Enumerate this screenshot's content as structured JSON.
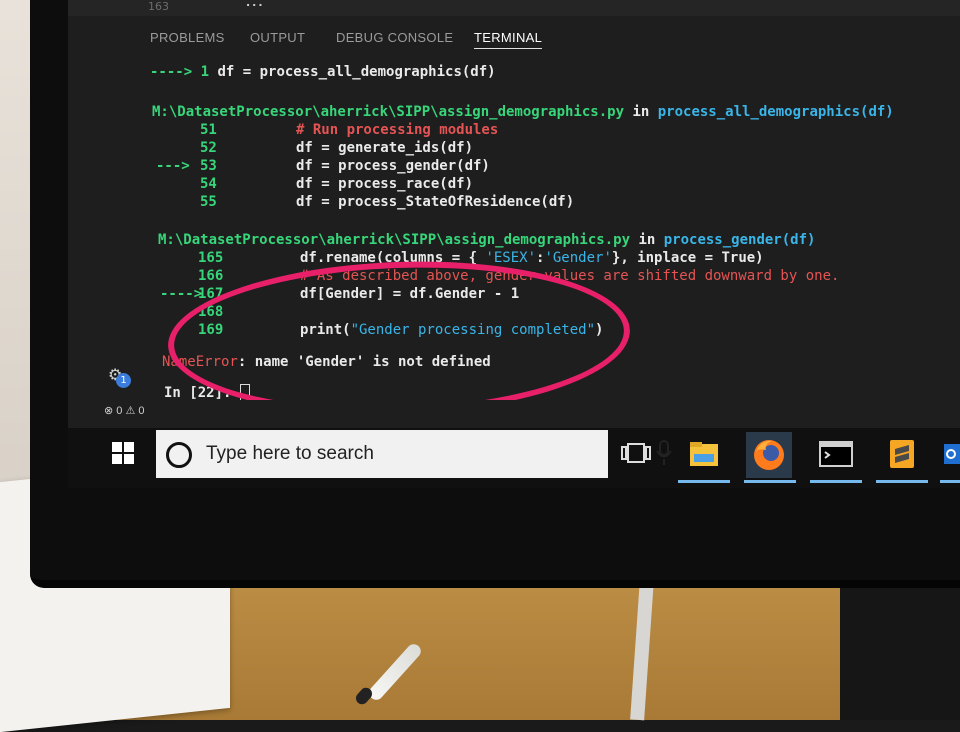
{
  "window": {
    "top_line_number": "163",
    "top_ellipsis": "..."
  },
  "panel_tabs": [
    "PROBLEMS",
    "OUTPUT",
    "DEBUG CONSOLE",
    "TERMINAL"
  ],
  "active_tab": "TERMINAL",
  "terminal": {
    "l1_arrow": "----> 1",
    "l1_code": " df = process_all_demographics(df)",
    "trace1_path": "M:\\DatasetProcessor\\aherrick\\SIPP\\assign_demographics.py",
    "trace1_in": " in ",
    "trace1_func": "process_all_demographics(df)",
    "t1_rows": [
      {
        "num": "51",
        "code": "# Run processing modules"
      },
      {
        "num": "52",
        "code": "df = generate_ids(df)"
      },
      {
        "num": "53",
        "code": "df = process_gender(df)"
      },
      {
        "num": "54",
        "code": "df = process_race(df)"
      },
      {
        "num": "55",
        "code": "df = process_StateOfResidence(df)"
      }
    ],
    "t1_arrow": "--->",
    "trace2_path": "M:\\DatasetProcessor\\aherrick\\SIPP\\assign_demographics.py",
    "trace2_in": " in ",
    "trace2_func": "process_gender(df)",
    "r165_num": "165",
    "r165_a": "df.rename(columns = { ",
    "r165_s1": "'ESEX'",
    "r165_colon": ":",
    "r165_s2": "'Gender'",
    "r165_b": "}, inplace = True)",
    "r166_num": "166",
    "r166_comment": "# As described above, gender values are shifted downward by one.",
    "r167_arrow": "---->",
    "r167_num": "167",
    "r167_code": "df[Gender] = df.Gender - 1",
    "r168_num": "168",
    "r169_num": "169",
    "r169_a": "print(",
    "r169_s": "\"Gender processing completed\"",
    "r169_b": ")",
    "error_type": "NameError",
    "error_msg": ": name 'Gender' is not defined",
    "prompt": "In [22]: "
  },
  "status_bar": {
    "problems": "⊗ 0 ⚠ 0",
    "badge_count": "1"
  },
  "taskbar": {
    "search_placeholder": "Type here to search",
    "apps": [
      "task-view",
      "file-explorer",
      "firefox",
      "command-prompt",
      "sublime-text"
    ]
  },
  "colors": {
    "annotation_circle": "#e8206a",
    "terminal_bg": "#1e1e1e",
    "path_green": "#37d67a",
    "func_cyan": "#3ab5e8",
    "error_red": "#e55454"
  }
}
